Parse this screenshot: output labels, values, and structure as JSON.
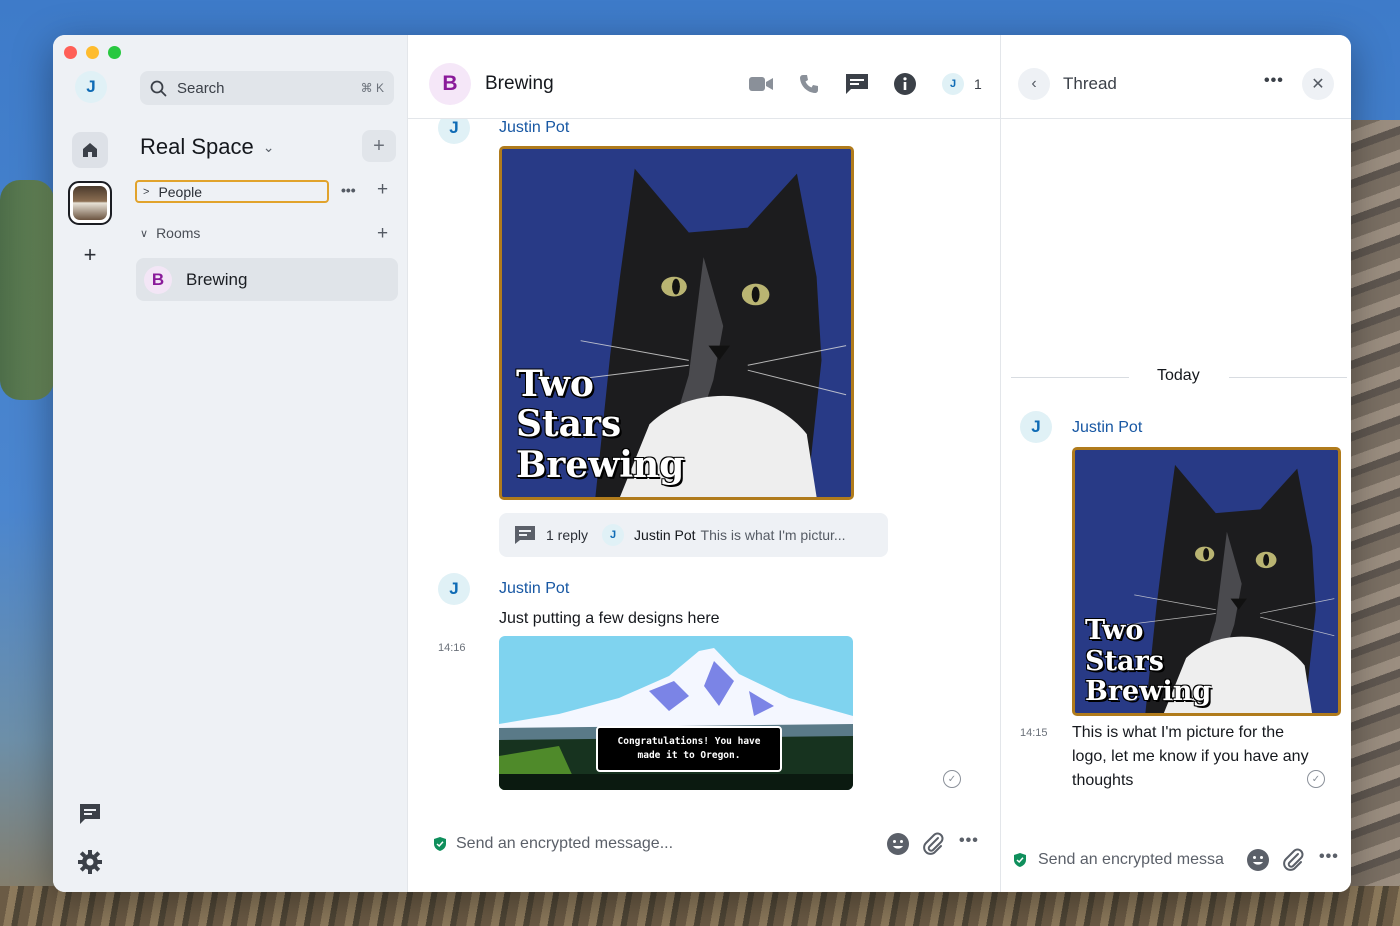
{
  "rail": {
    "user_initial": "J",
    "add_symbol": "+"
  },
  "sidebar": {
    "search_label": "Search",
    "search_shortcut": "⌘ K",
    "space_title": "Real Space",
    "people_label": "People",
    "rooms_label": "Rooms",
    "room": {
      "initial": "B",
      "name": "Brewing"
    }
  },
  "header": {
    "room_initial": "B",
    "room_name": "Brewing",
    "member_initial": "J",
    "member_count": "1"
  },
  "timeline": {
    "msg1": {
      "sender_initial": "J",
      "sender": "Justin Pot",
      "image_caption": [
        "Two",
        "Stars",
        "Brewing"
      ],
      "thread": {
        "reply_count": "1 reply",
        "avatar_initial": "J",
        "author": "Justin Pot",
        "preview": "This is what I'm pictur..."
      }
    },
    "msg2": {
      "sender_initial": "J",
      "sender": "Justin Pot",
      "text": "Just putting a few designs here",
      "time": "14:16",
      "image_box_text": "Congratulations! You have made it to Oregon."
    },
    "composer_placeholder": "Send an encrypted message..."
  },
  "thread": {
    "title": "Thread",
    "more": "•••",
    "date_separator": "Today",
    "sender_initial": "J",
    "sender": "Justin Pot",
    "image_caption": [
      "Two",
      "Stars",
      "Brewing"
    ],
    "time": "14:15",
    "text": "This is what I'm picture for the logo, let me know if you have any thoughts",
    "composer_placeholder": "Send an encrypted messa"
  },
  "colors": {
    "accent_blue": "#1757a3",
    "room_purple": "#8a1a9a",
    "focus_orange": "#e1a32c",
    "verified_green": "#0f8f5c"
  }
}
